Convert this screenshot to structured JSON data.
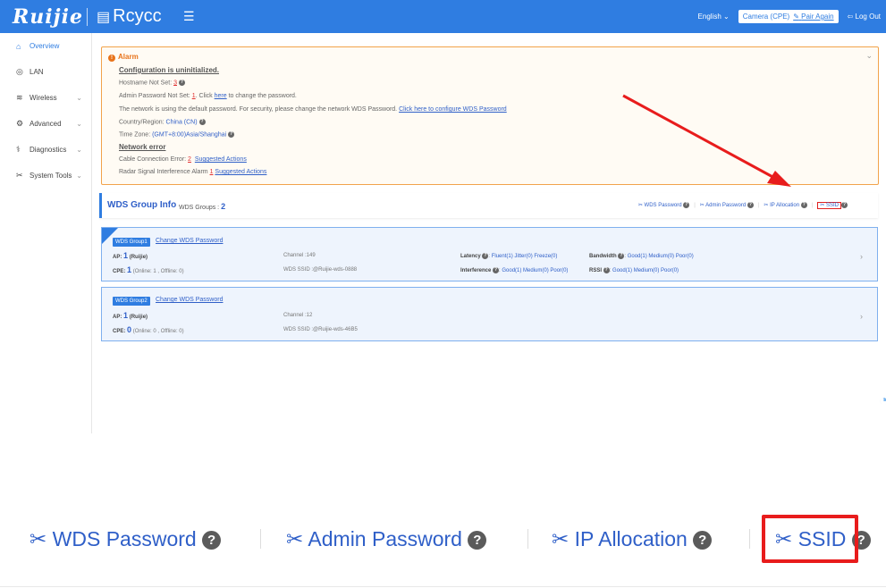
{
  "header": {
    "logo": "Ruijie",
    "brand": "Rcycc",
    "language": "English",
    "mode": "Camera (CPE)",
    "pair_again": "Pair Again",
    "logout": "Log Out",
    "accent_color": "#2f7de1"
  },
  "sidebar": {
    "items": [
      {
        "label": "Overview",
        "icon": "home-icon"
      },
      {
        "label": "LAN",
        "icon": "globe-icon"
      },
      {
        "label": "Wireless",
        "icon": "wifi-icon"
      },
      {
        "label": "Advanced",
        "icon": "gear-icon"
      },
      {
        "label": "Diagnostics",
        "icon": "stethoscope-icon"
      },
      {
        "label": "System Tools",
        "icon": "tools-icon"
      }
    ]
  },
  "alarm": {
    "title": "Alarm",
    "config_head": "Configuration is uninitialized.",
    "hostname_label": "Hostname Not Set:",
    "hostname_count": "3",
    "admin_label": "Admin Password Not Set:",
    "admin_count": "1",
    "admin_click": ". Click",
    "admin_here": "here",
    "admin_rest": "to change the password.",
    "wds_text": "The network is using the default password. For security, please change the network WDS Password.",
    "wds_link": "Click here to configure WDS Password",
    "country_label": "Country/Region:",
    "country_value": "China (CN)",
    "tz_label": "Time Zone:",
    "tz_value": "(GMT+8:00)Asia/Shanghai",
    "network_head": "Network error",
    "cable_label": "Cable Connection Error:",
    "cable_count": "2",
    "cable_link": "Suggested Actions",
    "radar_label": "Radar Signal Interference Alarm",
    "radar_count": "1",
    "radar_link": "Suggested Actions"
  },
  "wds": {
    "title": "WDS Group Info",
    "groups_label": "WDS Groups :",
    "groups_count": "2",
    "actions": {
      "wds_password": "WDS Password",
      "admin_password": "Admin Password",
      "ip_allocation": "IP Allocation",
      "ssid": "SSID"
    },
    "group1": {
      "tag": "WDS Group1",
      "change": "Change WDS Password",
      "ap_label": "AP:",
      "ap_count": "1",
      "ap_name": "(Ruijie)",
      "cpe_label": "CPE:",
      "cpe_count": "1",
      "cpe_detail": "(Online: 1 , Offline: 0)",
      "channel": "Channel :149",
      "ssid": "WDS SSID :@Ruijie-wds-0888",
      "latency": "Latency",
      "latency_vals": "Fluent(1)  Jitter(0)  Freeze(0)",
      "bandwidth": "Bandwidth",
      "bandwidth_vals": "Good(1)  Medium(0)  Poor(0)",
      "interference": "Interference",
      "interference_vals": "Good(1)  Medium(0)  Poor(0)",
      "rssi": "RSSI",
      "rssi_vals": "Good(1)  Medium(0)  Poor(0)"
    },
    "group2": {
      "tag": "WDS Group2",
      "change": "Change WDS Password",
      "ap_label": "AP:",
      "ap_count": "1",
      "ap_name": "(Ruijie)",
      "cpe_label": "CPE:",
      "cpe_count": "0",
      "cpe_detail": "(Online: 0 , Offline: 0)",
      "channel": "Channel :12",
      "ssid": "WDS SSID :@Ruijie-wds-46B5"
    }
  },
  "zoom": {
    "wds_password": "WDS Password",
    "admin_password": "Admin Password",
    "ip_allocation": "IP Allocation",
    "ssid": "SSID",
    "highlight_color": "#e81c1c"
  }
}
